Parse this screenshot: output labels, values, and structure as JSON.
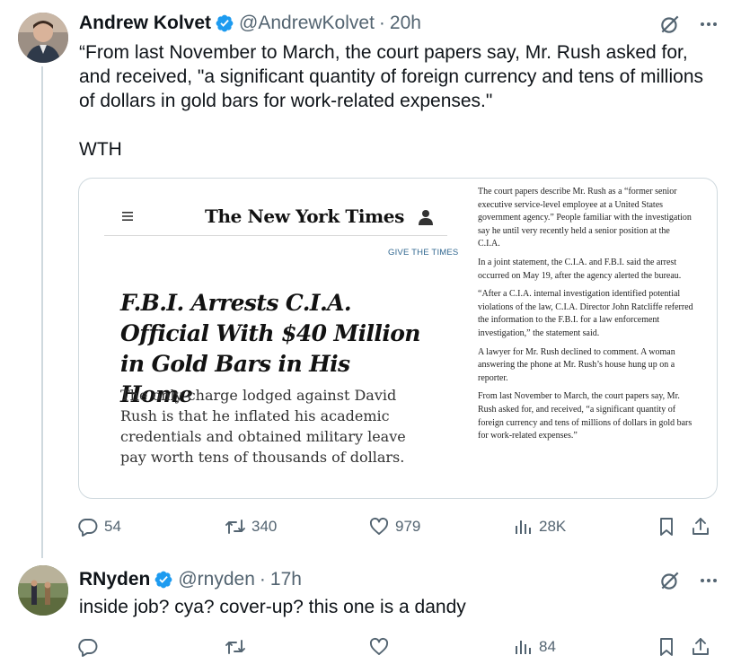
{
  "tweet1": {
    "name": "Andrew Kolvet",
    "handle": "@AndrewKolvet",
    "separator": "·",
    "time": "20h",
    "text": "“From last November to March, the court papers say, Mr. Rush asked for, and received, \"a significant quantity of foreign currency and tens of millions of dollars in gold bars for work-related expenses.\"\n\nWTH",
    "embed": {
      "logo": "The New York Times",
      "give": "GIVE THE TIMES",
      "headline": "F.B.I. Arrests C.I.A. Official With $40 Million in Gold Bars in His Home",
      "summary": "The only charge lodged against David Rush is that he inflated his academic credentials and obtained military leave pay worth tens of thousands of dollars.",
      "paragraphs": [
        "The court papers describe Mr. Rush as a “former senior executive service-level employee at a United States government agency.” People familiar with the investigation say he until very recently held a senior position at the C.I.A.",
        "In a joint statement, the C.I.A. and F.B.I. said the arrest occurred on May 19, after the agency alerted the bureau.",
        "“After a C.I.A. internal investigation identified potential violations of the law, C.I.A. Director John Ratcliffe referred the information to the F.B.I. for a law enforcement investigation,” the statement said.",
        "A lawyer for Mr. Rush declined to comment. A woman answering the phone at Mr. Rush’s house hung up on a reporter.",
        "From last November to March, the court papers say, Mr. Rush asked for, and received, “a significant quantity of foreign currency and tens of millions of dollars in gold bars for work-related expenses.”"
      ]
    },
    "stats": {
      "replies": "54",
      "retweets": "340",
      "likes": "979",
      "views": "28K"
    }
  },
  "tweet2": {
    "name": "RNyden",
    "handle": "@rnyden",
    "separator": "·",
    "time": "17h",
    "text": "inside job? cya? cover-up? this one is a dandy",
    "stats": {
      "replies": "",
      "retweets": "",
      "likes": "",
      "views": "84"
    }
  },
  "colors": {
    "verified": "#1d9bf0",
    "muted": "#536471",
    "border": "#cfd9de",
    "link": "#326891"
  },
  "icons": [
    "verified-icon",
    "grok-icon",
    "more-icon",
    "reply-icon",
    "retweet-icon",
    "like-icon",
    "views-icon",
    "bookmark-icon",
    "share-icon",
    "menu-icon",
    "user-icon"
  ]
}
